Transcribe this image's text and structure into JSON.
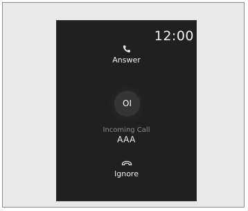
{
  "screen": {
    "clock": "12:00"
  },
  "actions": {
    "answer": {
      "label": "Answer",
      "icon": "phone-icon"
    },
    "ignore": {
      "label": "Ignore",
      "icon": "hang-up-icon"
    }
  },
  "caller": {
    "initials": "OI",
    "status": "Incoming Call",
    "name": "AAA"
  },
  "colors": {
    "screen_bg": "#202020",
    "frame_bg": "#e9e9e9",
    "text": "#f0f0f0",
    "muted_text": "#8d8d8d"
  }
}
